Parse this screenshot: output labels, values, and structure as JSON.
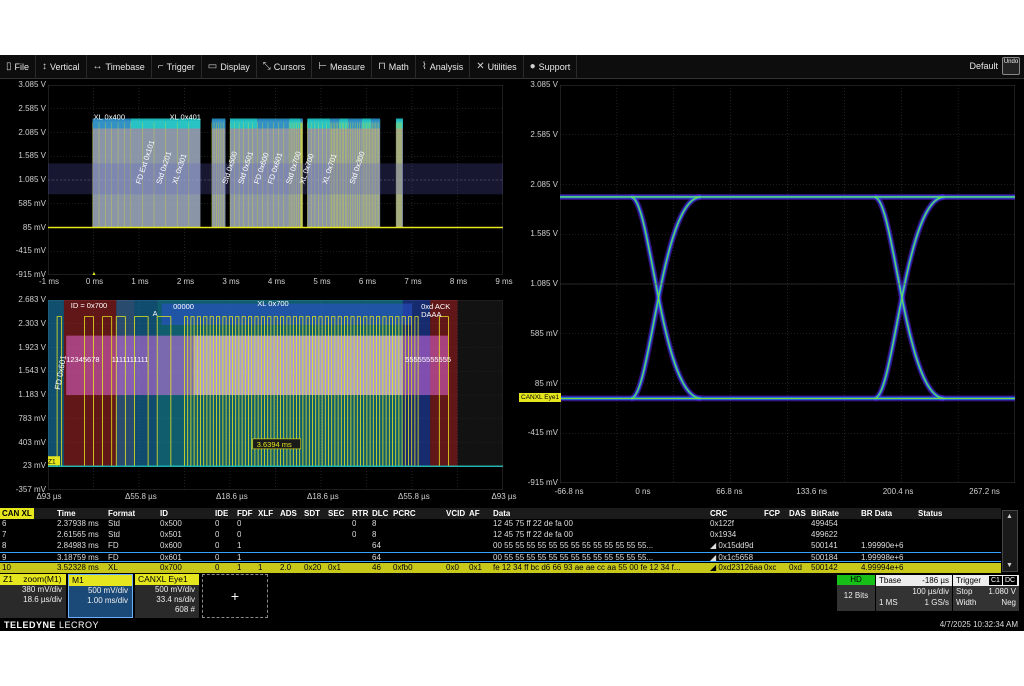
{
  "menu": {
    "items": [
      {
        "icon": "file-icon",
        "glyph": "▯",
        "label": "File"
      },
      {
        "icon": "vertical-icon",
        "glyph": "↕",
        "label": "Vertical"
      },
      {
        "icon": "timebase-icon",
        "glyph": "↔",
        "label": "Timebase"
      },
      {
        "icon": "trigger-icon",
        "glyph": "⌐",
        "label": "Trigger"
      },
      {
        "icon": "display-icon",
        "glyph": "▭",
        "label": "Display"
      },
      {
        "icon": "cursors-icon",
        "glyph": "⤡",
        "label": "Cursors"
      },
      {
        "icon": "measure-icon",
        "glyph": "⊢",
        "label": "Measure"
      },
      {
        "icon": "math-icon",
        "glyph": "⊓",
        "label": "Math"
      },
      {
        "icon": "analysis-icon",
        "glyph": "⌇",
        "label": "Analysis"
      },
      {
        "icon": "utilities-icon",
        "glyph": "✕",
        "label": "Utilities"
      },
      {
        "icon": "support-icon",
        "glyph": "●",
        "label": "Support"
      }
    ],
    "default_label": "Default",
    "undo_label": "Undo"
  },
  "top_left": {
    "y_ticks": [
      "3.085 V",
      "2.585 V",
      "2.085 V",
      "1.585 V",
      "1.085 V",
      "585 mV",
      "85 mV",
      "-415 mV",
      "-915 mV"
    ],
    "x_ticks": [
      "-1 ms",
      "0 ms",
      "1 ms",
      "2 ms",
      "3 ms",
      "4 ms",
      "5 ms",
      "6 ms",
      "7 ms",
      "8 ms",
      "9 ms"
    ],
    "frame_labels_top": [
      "XL 0x400",
      "XL 0x401"
    ],
    "frame_labels_rot": [
      "FD Ext 0x101",
      "Std 0x201",
      "XL 0x301",
      "Std 0x500",
      "Std 0x501",
      "FD 0x600",
      "FD 0x601",
      "Std 0x700",
      "XL 0x700",
      "XL 0x701",
      "Std 0x300"
    ]
  },
  "bottom_left": {
    "y_ticks": [
      "2.683 V",
      "2.303 V",
      "1.923 V",
      "1.543 V",
      "1.183 V",
      "783 mV",
      "403 mV",
      "23 mV",
      "-357 mV"
    ],
    "x_ticks": [
      "Δ93 µs",
      "Δ55.8 µs",
      "Δ18.6 µs",
      "Δ18.6 µs",
      "Δ55.8 µs",
      "Δ93 µs"
    ],
    "labels": {
      "id": "ID = 0x700",
      "a": "A",
      "zeros": "00000",
      "xl": "XL 0x700",
      "ack": "0xd ACK",
      "daaa": "DAAA",
      "fd": "FD 0x601",
      "seq_left": "12345678",
      "seq_mid": "1111111111",
      "seq_right": "55555555555",
      "measure": "3.6394 ms",
      "z1_marker": "Z1"
    }
  },
  "right": {
    "y_ticks": [
      "3.085 V",
      "2.585 V",
      "2.085 V",
      "1.585 V",
      "1.085 V",
      "585 mV",
      "85 mV",
      "-415 mV",
      "-915 mV"
    ],
    "x_ticks": [
      "-66.8 ns",
      "0 ns",
      "66.8 ns",
      "133.6 ns",
      "200.4 ns",
      "267.2 ns"
    ],
    "marker_label": "CANXL Eye1"
  },
  "table": {
    "headers": [
      "CAN XL",
      "Time",
      "Format",
      "ID",
      "IDE",
      "FDF",
      "XLF",
      "ADS",
      "SDT",
      "SEC",
      "RTR",
      "DLC",
      "PCRC",
      "VCID",
      "AF",
      "Data",
      "CRC",
      "FCP",
      "DAS",
      "BitRate",
      "BR Data",
      "Status"
    ],
    "rows": [
      {
        "idx": "6",
        "time": "2.37938 ms",
        "format": "Std",
        "id": "0x500",
        "ide": "0",
        "fdf": "0",
        "xlf": "",
        "ads": "",
        "sdt": "",
        "sec": "",
        "rtr": "0",
        "dlc": "8",
        "pcrc": "",
        "vcid": "",
        "af": "",
        "data": "12 45 75 ff 22 de fa 00",
        "crc": "0x122f",
        "fcp": "",
        "das": "",
        "bitrate": "499454",
        "brdata": "",
        "status": ""
      },
      {
        "idx": "7",
        "time": "2.61565 ms",
        "format": "Std",
        "id": "0x501",
        "ide": "0",
        "fdf": "0",
        "xlf": "",
        "ads": "",
        "sdt": "",
        "sec": "",
        "rtr": "0",
        "dlc": "8",
        "pcrc": "",
        "vcid": "",
        "af": "",
        "data": "12 45 75 ff 22 de fa 00",
        "crc": "0x1934",
        "fcp": "",
        "das": "",
        "bitrate": "499622",
        "brdata": "",
        "status": ""
      },
      {
        "idx": "8",
        "time": "2.84983 ms",
        "format": "FD",
        "id": "0x600",
        "ide": "0",
        "fdf": "1",
        "xlf": "",
        "ads": "",
        "sdt": "",
        "sec": "",
        "rtr": "",
        "dlc": "64",
        "pcrc": "",
        "vcid": "",
        "af": "",
        "data": "00 55 55 55 55 55 55 55 55 55 55 55 55 55...",
        "crc": "◢ 0x15dd9d",
        "fcp": "",
        "das": "",
        "bitrate": "500141",
        "brdata": "1.99990e+6",
        "status": ""
      },
      {
        "idx": "9",
        "time": "3.18759 ms",
        "format": "FD",
        "id": "0x601",
        "ide": "0",
        "fdf": "1",
        "xlf": "",
        "ads": "",
        "sdt": "",
        "sec": "",
        "rtr": "",
        "dlc": "64",
        "pcrc": "",
        "vcid": "",
        "af": "",
        "data": "00 55 55 55 55 55 55 55 55 55 55 55 55 55...",
        "crc": "◢ 0x1c5658",
        "fcp": "",
        "das": "",
        "bitrate": "500184",
        "brdata": "1.99998e+6",
        "status": ""
      },
      {
        "idx": "10",
        "time": "3.52328 ms",
        "format": "XL",
        "id": "0x700",
        "ide": "0",
        "fdf": "1",
        "xlf": "1",
        "ads": "2.0",
        "sdt": "0x20",
        "sec": "0x1",
        "rtr": "",
        "dlc": "46",
        "pcrc": "0xfb0",
        "vcid": "0x0",
        "af": "0x1",
        "data": "fe 12 34 ff bc d6 66 93 ae ae cc aa 55 00 fe 12 34 f...",
        "crc": "◢ 0xd23126aa",
        "fcp": "0xc",
        "das": "0xd",
        "bitrate": "500142",
        "brdata": "4.99994e+6",
        "status": ""
      }
    ]
  },
  "descriptors": {
    "z1": {
      "title": "Z1",
      "sub": "zoom(M1)",
      "v1": "380 mV/div",
      "v2": "18.6 µs/div"
    },
    "m1": {
      "title": "M1",
      "v1": "500 mV/div",
      "v2": "1.00 ms/div"
    },
    "eye": {
      "title": "CANXL Eye1",
      "v1": "500 mV/div",
      "v2": "33.4 ns/div",
      "v3": "608 #"
    },
    "add": "+"
  },
  "acq": {
    "hd": "HD",
    "bits": "12 Bits",
    "tbase_label": "Tbase",
    "tbase_value": "-186 µs",
    "tdiv": "100 µs/div",
    "samples": "1 MS",
    "rate": "1 GS/s",
    "trigger_label": "Trigger",
    "trig_c1": "C1",
    "trig_dc": "DC",
    "mode": "Stop",
    "level": "1.080 V",
    "type": "Width",
    "slope": "Neg"
  },
  "footer": {
    "brand_bold": "TELEDYNE",
    "brand_thin": "LECROY",
    "datetime": "4/7/2025 10:32:34 AM"
  },
  "colors": {
    "yellow": "#e6e61e",
    "cyan": "#1ec8c8",
    "blue": "#2a50c8",
    "pink": "#c878c8",
    "eye_purple": "#6a2ae0"
  }
}
